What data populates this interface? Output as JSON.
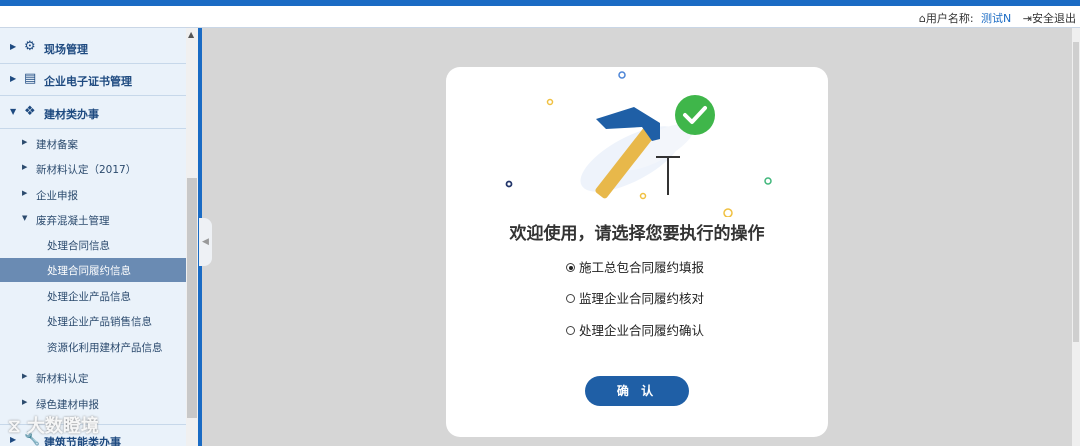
{
  "header": {
    "home_icon": "home-icon",
    "username_label": "用户名称:",
    "username": "测试N",
    "logout_label": "安全退出",
    "accent_color": "#1a6bc4"
  },
  "sidebar": {
    "sections": [
      {
        "label": "现场管理",
        "icon": "gears-icon",
        "expanded": false
      },
      {
        "label": "企业电子证书管理",
        "icon": "certificate-icon",
        "expanded": false
      },
      {
        "label": "建材类办事",
        "icon": "cubes-icon",
        "expanded": true
      }
    ],
    "items": [
      {
        "label": "建材备案"
      },
      {
        "label": "新材料认定（2017）"
      },
      {
        "label": "企业申报"
      },
      {
        "label": "废弃混凝土管理"
      }
    ],
    "subitems": [
      {
        "label": "处理合同信息",
        "active": false
      },
      {
        "label": "处理合同履约信息",
        "active": true
      },
      {
        "label": "处理企业产品信息",
        "active": false
      },
      {
        "label": "处理企业产品销售信息",
        "active": false
      },
      {
        "label": "资源化利用建材产品信息",
        "active": false
      }
    ],
    "items_after": [
      {
        "label": "新材料认定"
      },
      {
        "label": "绿色建材申报"
      }
    ],
    "bottom_section": {
      "label": "建筑节能类办事",
      "icon": "wrench-icon"
    },
    "watermark": "大数瞪境"
  },
  "dialog": {
    "title": "欢迎使用，请选择您要执行的操作",
    "options": [
      {
        "label": "施工总包合同履约填报",
        "checked": true
      },
      {
        "label": "监理企业合同履约核对",
        "checked": false
      },
      {
        "label": "处理企业合同履约确认",
        "checked": false
      }
    ],
    "confirm_label": "确 认"
  }
}
